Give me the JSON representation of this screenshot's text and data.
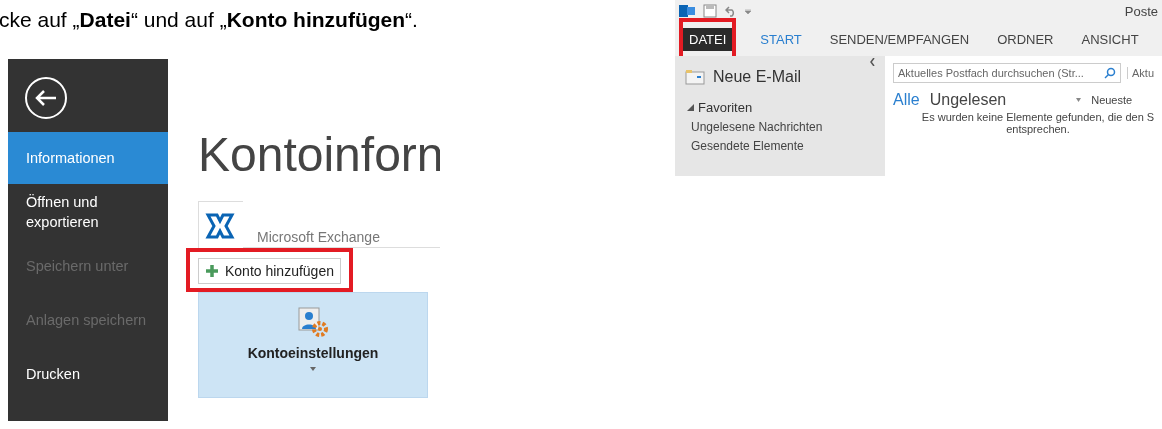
{
  "instruction": {
    "text": "cke auf „**Datei**“ und auf „**Konto hinzufügen**“."
  },
  "backstage": {
    "menu": [
      {
        "label": "Informationen",
        "selected": true,
        "disabled": false
      },
      {
        "label": "Öffnen und exportieren",
        "selected": false,
        "disabled": false
      },
      {
        "label": "Speichern unter",
        "selected": false,
        "disabled": true
      },
      {
        "label": "Anlagen speichern",
        "selected": false,
        "disabled": true
      },
      {
        "label": "Drucken",
        "selected": false,
        "disabled": false
      }
    ],
    "title": "Kontoinforn",
    "account": {
      "name": "Microsoft Exchange"
    },
    "add_account_button": {
      "label": "Konto hinzufügen",
      "highlighted": true
    },
    "settings_tile": {
      "label": "Kontoeinstellungen"
    }
  },
  "outlook": {
    "title": "Poste",
    "tabs": [
      {
        "label": "DATEI",
        "kind": "file",
        "selected": false,
        "highlighted": true
      },
      {
        "label": "START",
        "kind": "tab",
        "selected": true,
        "highlighted": false
      },
      {
        "label": "SENDEN/EMPFANGEN",
        "kind": "tab",
        "selected": false,
        "highlighted": false
      },
      {
        "label": "ORDNER",
        "kind": "tab",
        "selected": false,
        "highlighted": false
      },
      {
        "label": "ANSICHT",
        "kind": "tab",
        "selected": false,
        "highlighted": false
      }
    ],
    "new_email_button": {
      "label": "Neue E-Mail"
    },
    "folders": [
      {
        "label": "Favoriten",
        "expanded": true,
        "children": [
          {
            "label": "Ungelesene Nachrichten"
          },
          {
            "label": "Gesendete Elemente"
          }
        ]
      }
    ],
    "search": {
      "placeholder": "Aktuelles Postfach durchsuchen (Str...",
      "scope": "Aktu"
    },
    "filters": [
      {
        "label": "Alle",
        "selected": true
      },
      {
        "label": "Ungelesen",
        "selected": false
      }
    ],
    "sort": {
      "label": "Neueste"
    },
    "empty_message": "Es wurden keine Elemente gefunden, die den S\nentsprechen."
  }
}
